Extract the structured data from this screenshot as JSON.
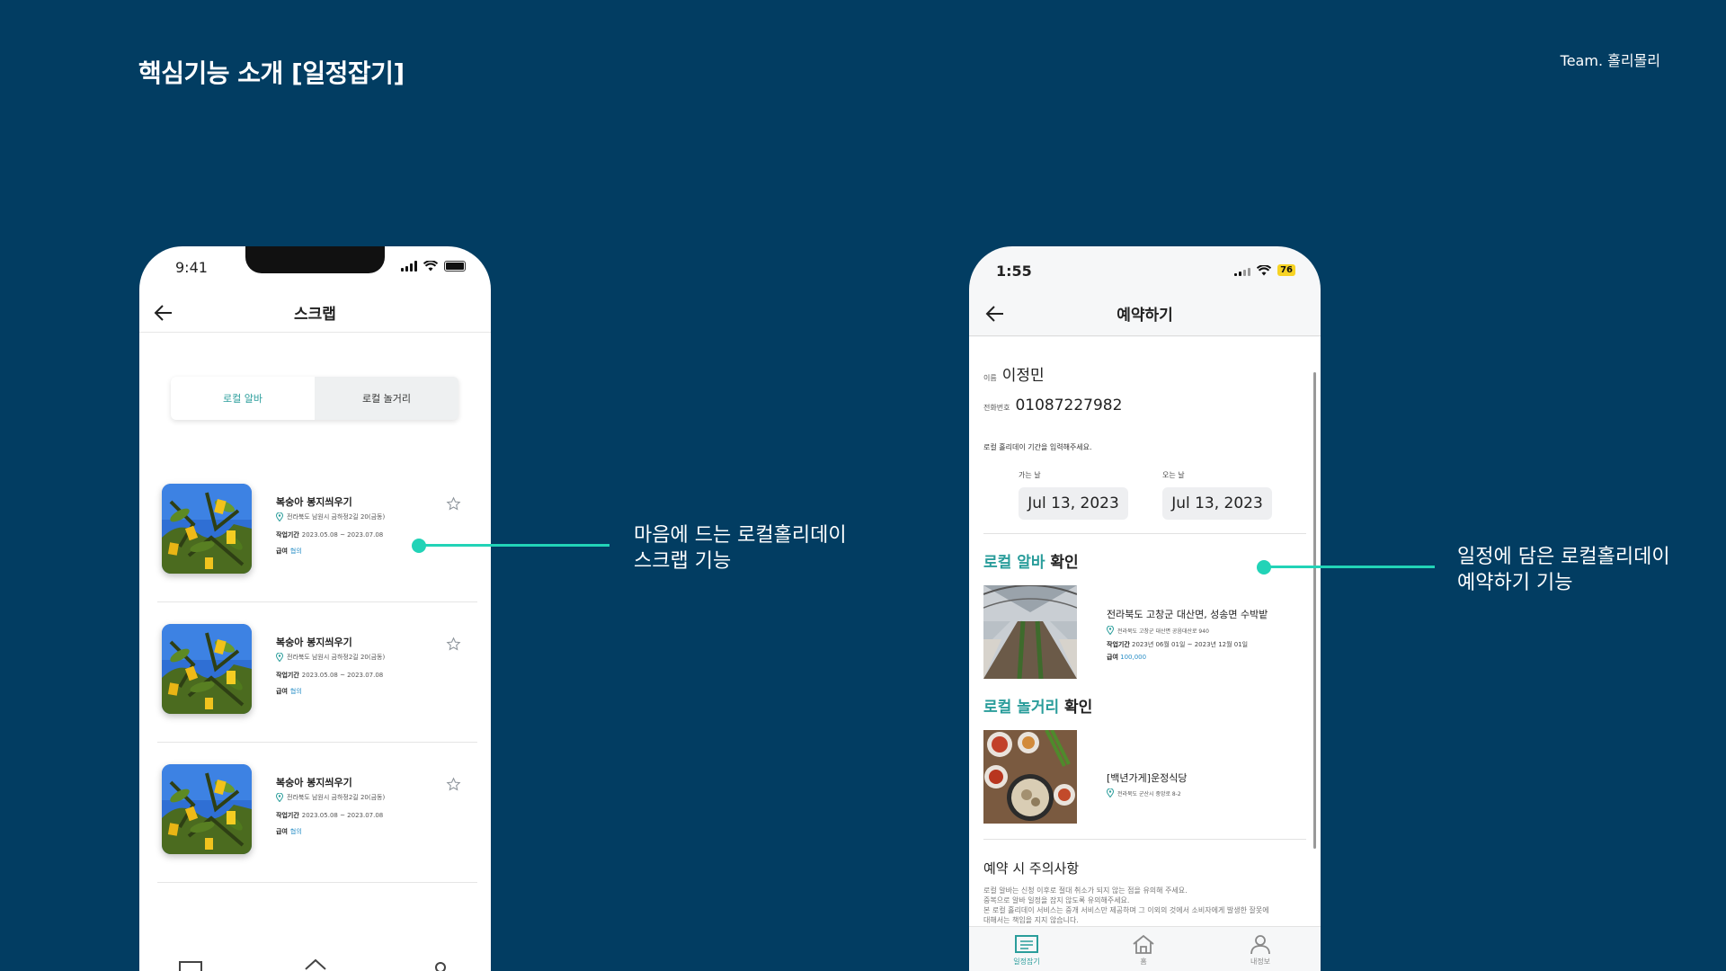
{
  "slide": {
    "title": "핵심기능 소개 [일정잡기]",
    "team": "Team. 홀리몰리"
  },
  "phone1": {
    "time": "9:41",
    "header_title": "스크랩",
    "segments": [
      "로컬 알바",
      "로컬 놀거리"
    ],
    "cards": [
      {
        "title": "복숭아 봉지씌우기",
        "location": "전라북도 남원시 금하정2길 20(금동)",
        "period_label": "작업기간",
        "period": "2023.05.08 ~ 2023.07.08",
        "pay_label": "급여",
        "pay": "협의"
      },
      {
        "title": "복숭아 봉지씌우기",
        "location": "전라북도 남원시 금하정2길 20(금동)",
        "period_label": "작업기간",
        "period": "2023.05.08 ~ 2023.07.08",
        "pay_label": "급여",
        "pay": "협의"
      },
      {
        "title": "복숭아 봉지씌우기",
        "location": "전라북도 남원시 금하정2길 20(금동)",
        "period_label": "작업기간",
        "period": "2023.05.08 ~ 2023.07.08",
        "pay_label": "급여",
        "pay": "협의"
      }
    ]
  },
  "phone2": {
    "time": "1:55",
    "battery": "76",
    "header_title": "예약하기",
    "name_label": "이름",
    "name": "이정민",
    "phone_label": "전화번호",
    "phone": "01087227982",
    "period_msg": "로컬 홀리데이 기간을 입력해주세요.",
    "go_label": "가는 날",
    "go_date": "Jul 13, 2023",
    "come_label": "오는 날",
    "come_date": "Jul 13, 2023",
    "job_section_teal": "로컬 알바",
    "job_section_rest": " 확인",
    "job_title": "전라북도 고창군 대산면, 성송면 수박밭",
    "job_location": "전라북도 고창군 대산면 공음대산로 940",
    "job_period_label": "작업기간",
    "job_period": "2023년 06월 01일 ~ 2023년 12월 01일",
    "job_pay_label": "급여",
    "job_pay": "100,000",
    "play_section_teal": "로컬 놀거리",
    "play_section_rest": " 확인",
    "play_title": "[백년가게]운정식당",
    "play_location": "전라북도 군산시 중앙로 8-2",
    "notice_title": "예약 시 주의사항",
    "notice_lines": [
      "로컬 알바는 신청 이후로 절대 취소가 되지 않는 점을 유의해 주세요.",
      "중복으로 알바 일정을 잡지 않도록 유의해주세요.",
      "본 로컬 홀리데이 서비스는 중개 서비스만 제공하며 그 이외의 것에서 소비자에게 발생한 잘못에",
      "대해서는 책임을 지지 않습니다."
    ],
    "tabs": [
      "일정잡기",
      "홈",
      "내정보"
    ]
  },
  "callouts": {
    "left": [
      "마음에 드는 로컬홀리데이",
      "스크랩 기능"
    ],
    "right": [
      "일정에 담은 로컬홀리데이",
      "예약하기 기능"
    ]
  },
  "colors": {
    "background": "#023d62",
    "accent": "#22d3b7",
    "teal": "#2a9d9b"
  }
}
